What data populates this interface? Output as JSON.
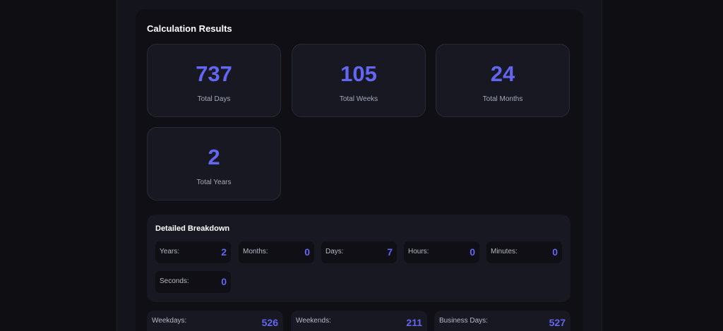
{
  "results": {
    "title": "Calculation Results",
    "stats": [
      {
        "value": "737",
        "label": "Total Days"
      },
      {
        "value": "105",
        "label": "Total Weeks"
      },
      {
        "value": "24",
        "label": "Total Months"
      },
      {
        "value": "2",
        "label": "Total Years"
      }
    ]
  },
  "breakdown": {
    "title": "Detailed Breakdown",
    "items": [
      {
        "label": "Years:",
        "value": "2"
      },
      {
        "label": "Months:",
        "value": "0"
      },
      {
        "label": "Days:",
        "value": "7"
      },
      {
        "label": "Hours:",
        "value": "0"
      },
      {
        "label": "Minutes:",
        "value": "0"
      },
      {
        "label": "Seconds:",
        "value": "0"
      }
    ]
  },
  "summary": [
    {
      "label": "Weekdays:",
      "value": "526"
    },
    {
      "label": "Weekends:",
      "value": "211"
    },
    {
      "label": "Business Days:",
      "value": "527"
    }
  ],
  "colors": {
    "accent": "#6366f1",
    "background": "#0e0e13",
    "card": "#181822"
  }
}
